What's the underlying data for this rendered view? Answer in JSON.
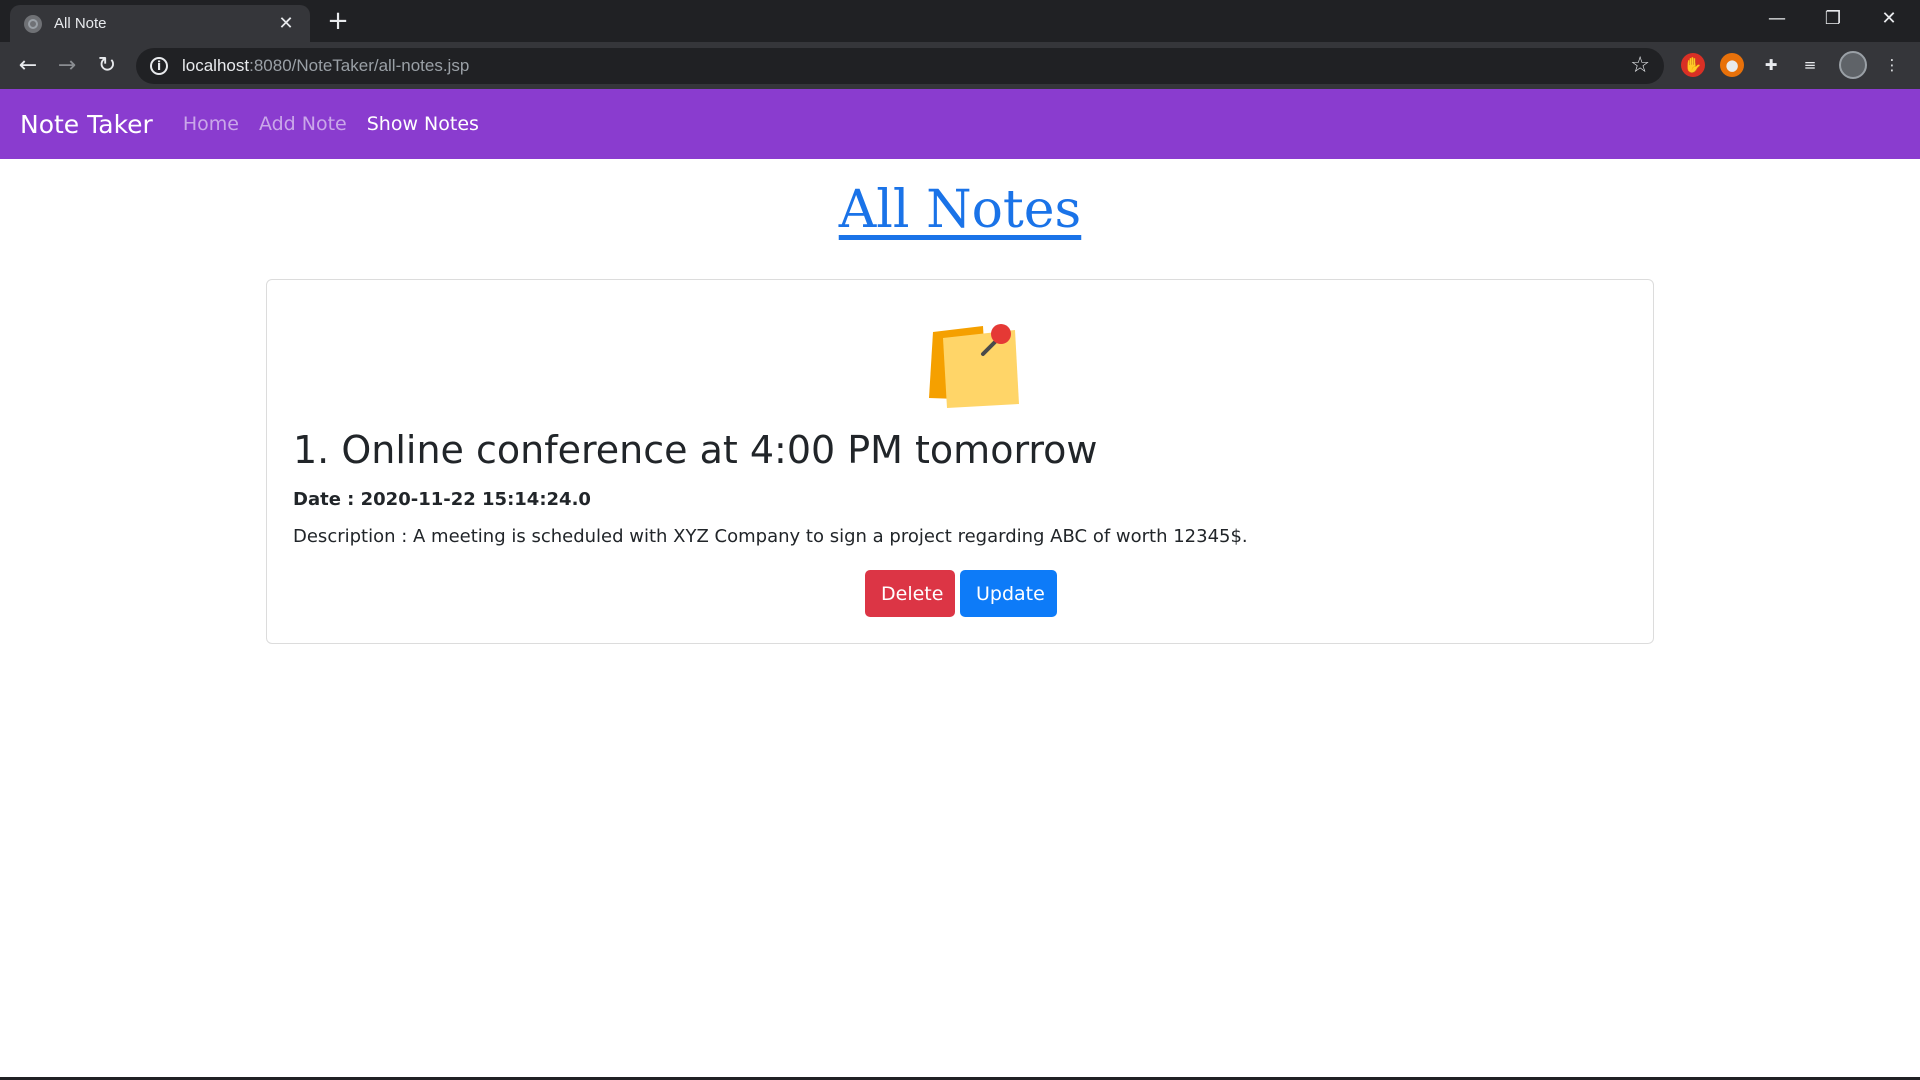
{
  "browser": {
    "tab_title": "All Note",
    "new_tab_symbol": "+",
    "close_tab_symbol": "✕",
    "window_controls": {
      "minimize": "—",
      "restore": "❐",
      "close": "✕"
    },
    "nav": {
      "back": "←",
      "forward": "→",
      "reload": "↻"
    },
    "url_host": "localhost",
    "url_path": ":8080/NoteTaker/all-notes.jsp",
    "bookmark_symbol": "☆",
    "menu_symbol": "⋮"
  },
  "navbar": {
    "brand": "Note Taker",
    "links": [
      {
        "label": "Home",
        "active": false
      },
      {
        "label": "Add Note",
        "active": false
      },
      {
        "label": "Show Notes",
        "active": true
      }
    ]
  },
  "page": {
    "heading": "All Notes",
    "notes": [
      {
        "title": "1. Online conference at 4:00 PM tomorrow",
        "date": "Date : 2020-11-22 15:14:24.0",
        "description": "Description : A meeting is scheduled with XYZ Company to sign a project regarding ABC of worth 12345$.",
        "icon": "sticky-note-icon",
        "actions": {
          "delete": "Delete",
          "update": "Update"
        }
      }
    ]
  },
  "colors": {
    "navbar_bg": "#8a3ccf",
    "heading_link": "#1a73e8",
    "delete_btn": "#dc3545",
    "update_btn": "#0d7bf8"
  }
}
